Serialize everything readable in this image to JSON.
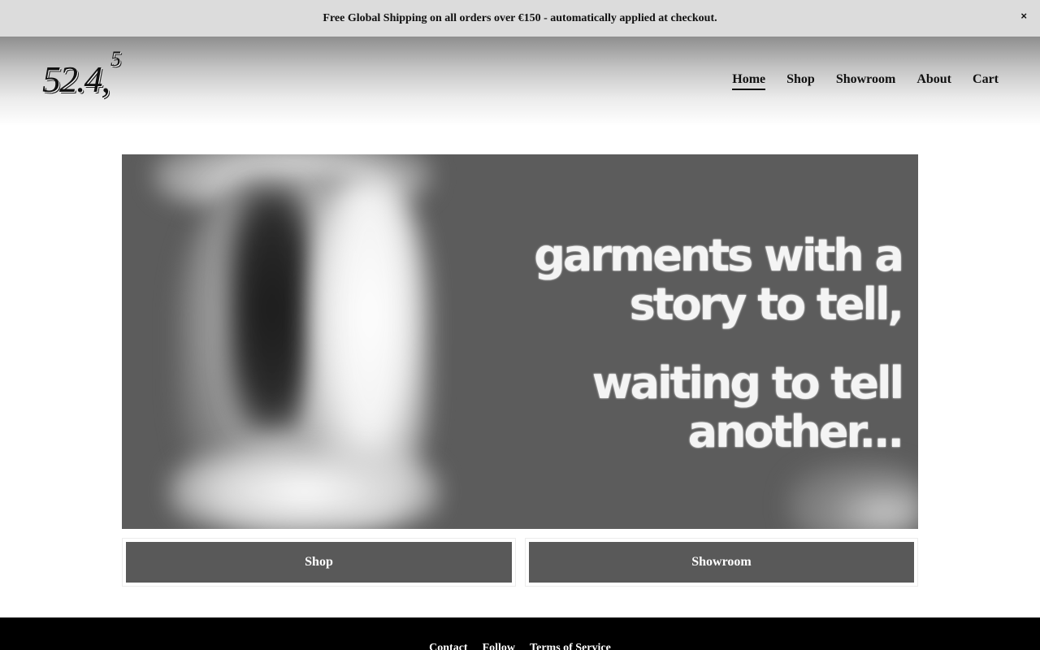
{
  "announcement": {
    "text": "Free Global Shipping on all orders over €150 - automatically applied at checkout.",
    "close_label": "×"
  },
  "header": {
    "logo_main": "52.4,",
    "logo_sup": "5",
    "nav": {
      "home": "Home",
      "shop": "Shop",
      "showroom": "Showroom",
      "about": "About",
      "cart": "Cart"
    },
    "active": "Home"
  },
  "hero": {
    "line1": "garments with a",
    "line2": "story to tell,",
    "line3": "waiting to tell another..."
  },
  "cta": {
    "shop": "Shop",
    "showroom": "Showroom"
  },
  "footer": {
    "links": [
      "Contact",
      "Follow",
      "Terms of Service"
    ]
  },
  "colors": {
    "announcement_bg": "#dcdcdc",
    "hero_bg": "#5c5c5c",
    "button_bg": "#595959",
    "footer_bg": "#000000"
  }
}
